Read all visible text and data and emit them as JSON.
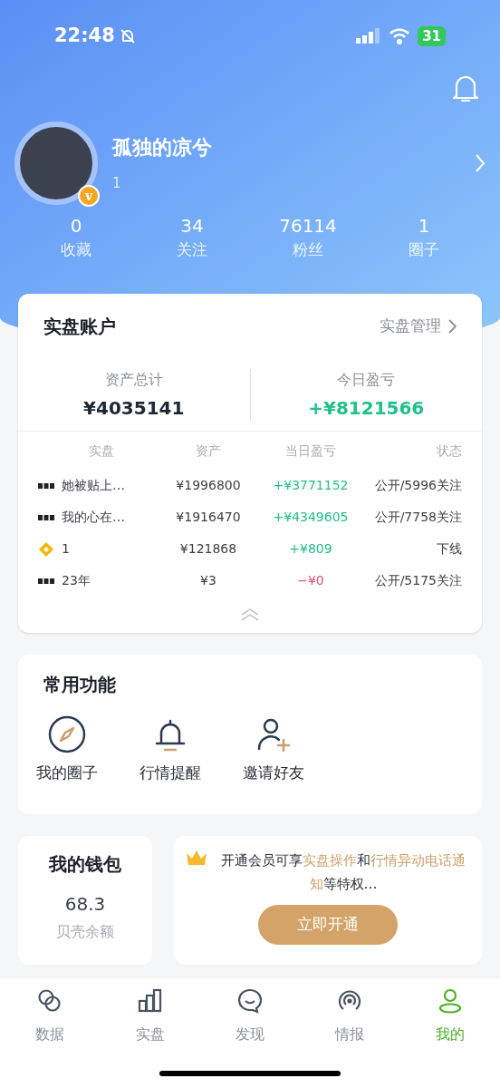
{
  "status_bar": {
    "time": "22:48",
    "battery": "31"
  },
  "profile": {
    "name": "孤独的凉兮",
    "subtitle": "1",
    "badge": "v",
    "stats": [
      {
        "value": "0",
        "label": "收藏"
      },
      {
        "value": "34",
        "label": "关注"
      },
      {
        "value": "76114",
        "label": "粉丝"
      },
      {
        "value": "1",
        "label": "圈子"
      }
    ]
  },
  "account": {
    "title": "实盘账户",
    "manage": "实盘管理",
    "summary": [
      {
        "label": "资产总计",
        "value": "¥4035141",
        "color": "#1f2733"
      },
      {
        "label": "今日盈亏",
        "value": "+¥8121566",
        "color": "#22c08a"
      }
    ],
    "columns": [
      "实盘",
      "资产",
      "当日盈亏",
      "状态"
    ],
    "rows": [
      {
        "kind": "okx",
        "name": "她被贴上…",
        "assets": "¥1996800",
        "pnl": "+¥3771152",
        "color": "#22c08a",
        "status": "公开/5996关注"
      },
      {
        "kind": "okx",
        "name": "我的心在…",
        "assets": "¥1916470",
        "pnl": "+¥4349605",
        "color": "#22c08a",
        "status": "公开/7758关注"
      },
      {
        "kind": "binance",
        "name": "1",
        "assets": "¥121868",
        "pnl": "+¥809",
        "color": "#22c08a",
        "status": "下线"
      },
      {
        "kind": "okx",
        "name": "23年",
        "assets": "¥3",
        "pnl": "−¥0",
        "color": "#e0507a",
        "status": "公开/5175关注"
      }
    ]
  },
  "functions": {
    "title": "常用功能",
    "items": [
      {
        "kind": "compass",
        "label": "我的圈子"
      },
      {
        "kind": "bell",
        "label": "行情提醒"
      },
      {
        "kind": "invite",
        "label": "邀请好友"
      }
    ]
  },
  "wallet": {
    "title": "我的钱包",
    "value": "68.3",
    "label": "贝壳余额"
  },
  "vip": {
    "segments": [
      {
        "text": "开通会员可享",
        "highlight": false
      },
      {
        "text": "实盘操作",
        "highlight": true
      },
      {
        "text": "和",
        "highlight": false
      },
      {
        "text": "行情异动电话通知",
        "highlight": true
      },
      {
        "text": "等特权…",
        "highlight": false
      }
    ],
    "button": "立即开通"
  },
  "tab_bar": [
    {
      "kind": "data",
      "label": "数据",
      "selected": false
    },
    {
      "kind": "chart",
      "label": "实盘",
      "selected": false
    },
    {
      "kind": "chat",
      "label": "发现",
      "selected": false
    },
    {
      "kind": "signal",
      "label": "情报",
      "selected": false
    },
    {
      "kind": "user",
      "label": "我的",
      "selected": true
    }
  ]
}
